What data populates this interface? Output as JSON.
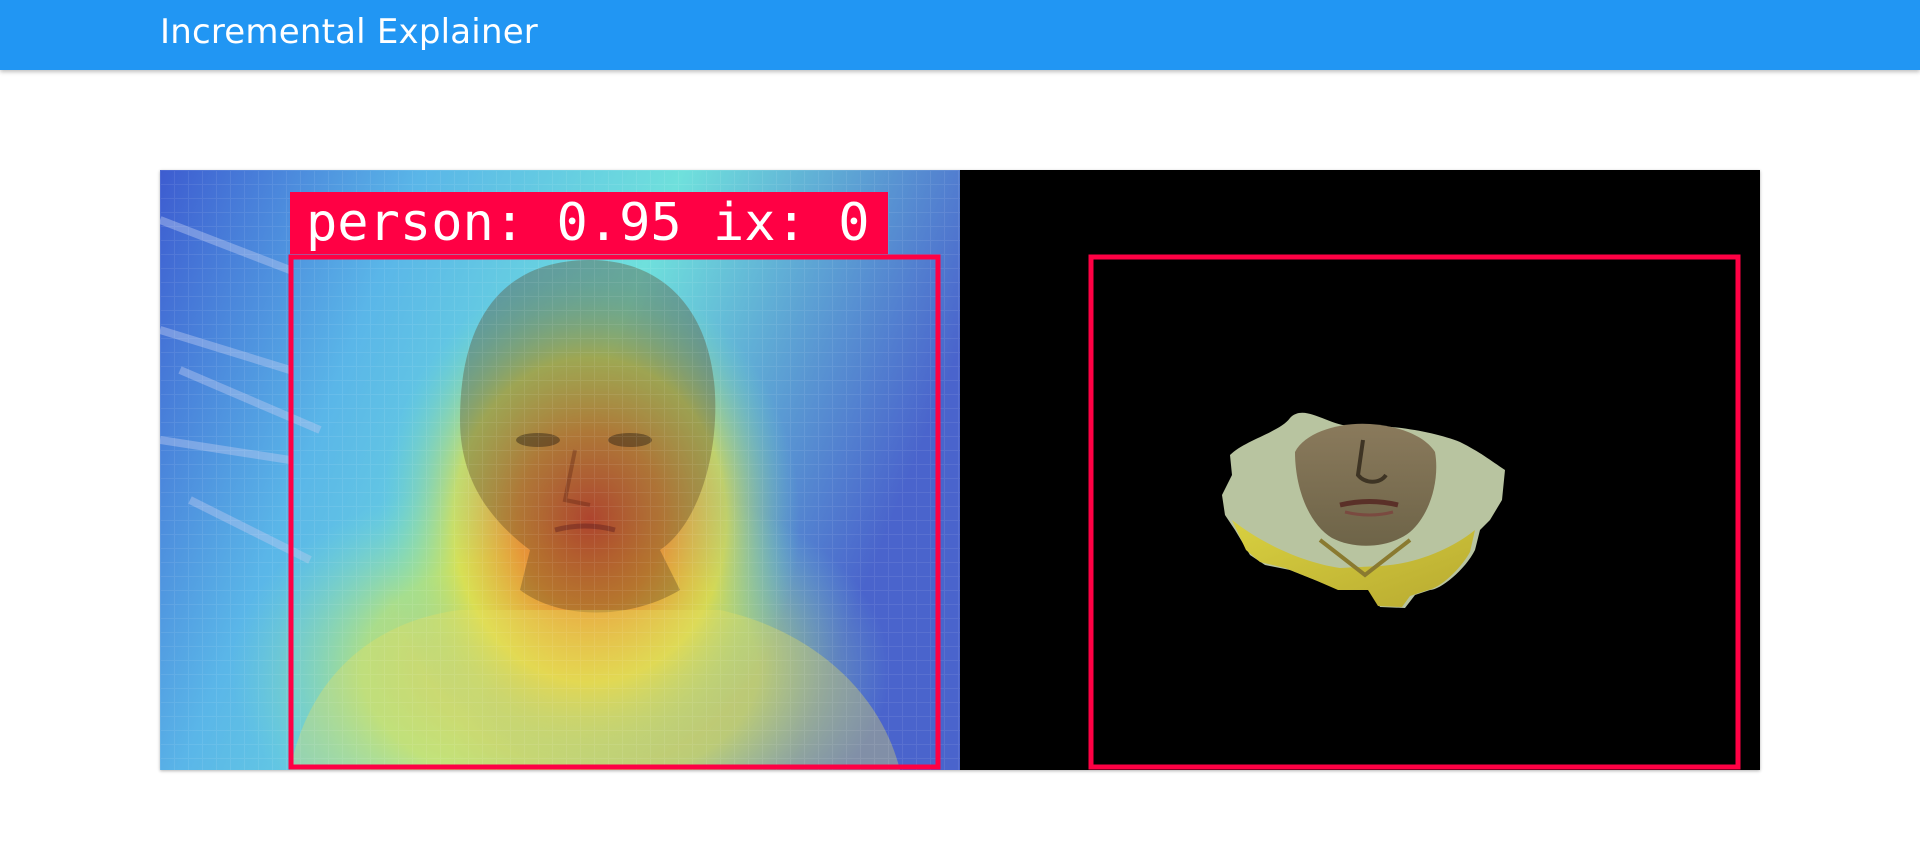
{
  "app": {
    "title": "Incremental Explainer"
  },
  "explanation": {
    "detection_label": "person: 0.95 ix: 0"
  },
  "colors": {
    "appbar": "#2196f3",
    "box": "#ff0044",
    "mask_background": "#000000"
  }
}
